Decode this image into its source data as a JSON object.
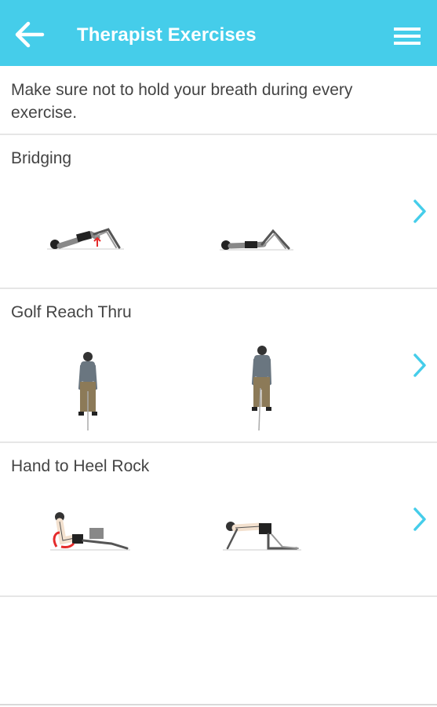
{
  "app_bar": {
    "title": "Therapist Exercises",
    "back_icon": "arrow-left-icon",
    "menu_icon": "hamburger-menu-icon",
    "background": "#45cdea"
  },
  "tip": "Make sure not to hold your breath during every exercise.",
  "accent_color": "#45cdea",
  "exercises": [
    {
      "name": "Bridging",
      "icon": "chevron-right-icon"
    },
    {
      "name": "Golf Reach Thru",
      "icon": "chevron-right-icon"
    },
    {
      "name": "Hand to Heel Rock",
      "icon": "chevron-right-icon"
    }
  ]
}
